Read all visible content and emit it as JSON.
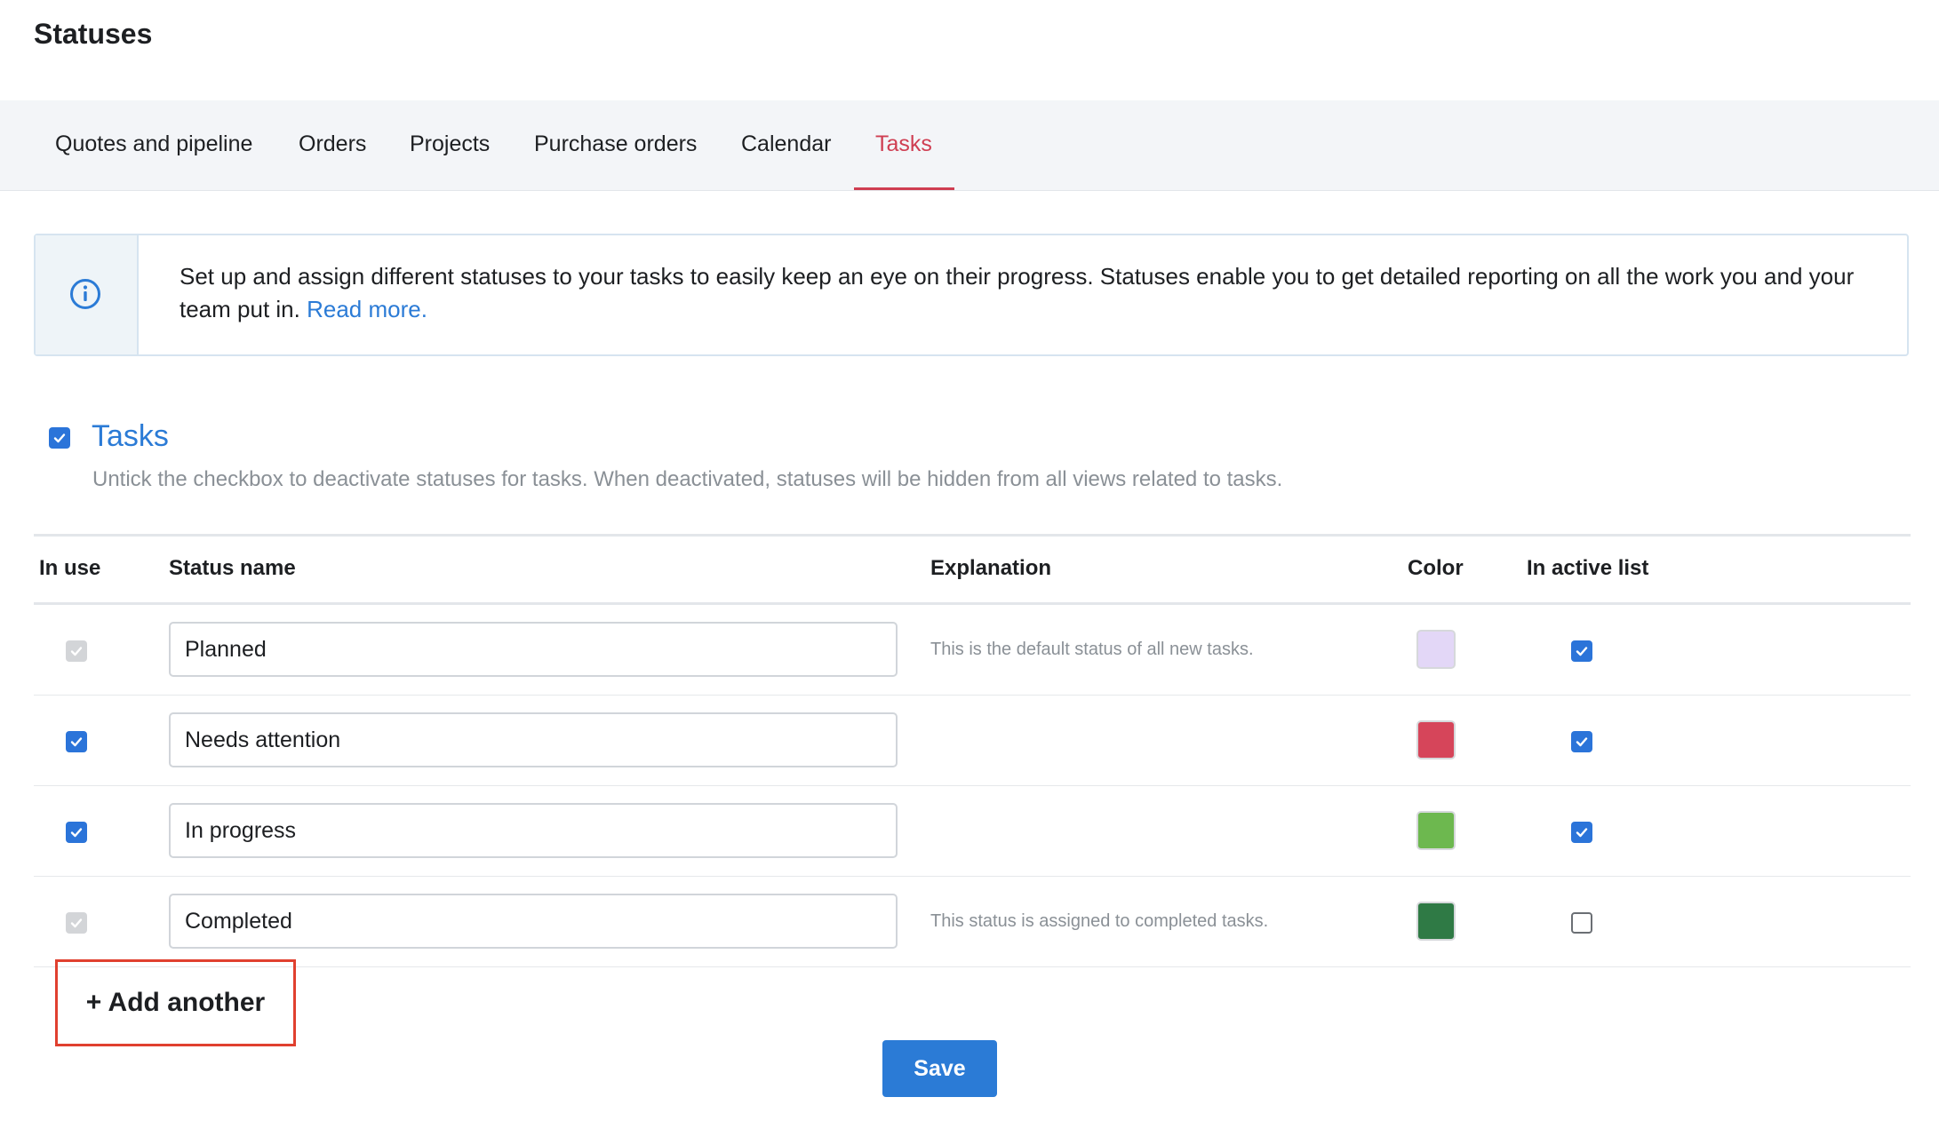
{
  "page": {
    "title": "Statuses"
  },
  "tabs": [
    {
      "label": "Quotes and pipeline",
      "active": false
    },
    {
      "label": "Orders",
      "active": false
    },
    {
      "label": "Projects",
      "active": false
    },
    {
      "label": "Purchase orders",
      "active": false
    },
    {
      "label": "Calendar",
      "active": false
    },
    {
      "label": "Tasks",
      "active": true
    }
  ],
  "info": {
    "text": "Set up and assign different statuses to your tasks to easily keep an eye on their progress. Statuses enable you to get detailed reporting on all the work you and your team put in.",
    "link": "Read more."
  },
  "section": {
    "title": "Tasks",
    "enabled": true,
    "description": "Untick the checkbox to deactivate statuses for tasks. When deactivated, statuses will be hidden from all views related to tasks."
  },
  "table": {
    "headers": {
      "in_use": "In use",
      "status_name": "Status name",
      "explanation": "Explanation",
      "color": "Color",
      "in_active_list": "In active list"
    },
    "rows": [
      {
        "in_use": "disabled",
        "name": "Planned",
        "explanation": "This is the default status of all new tasks.",
        "color": "#e3d7f7",
        "in_active_list": true
      },
      {
        "in_use": "checked",
        "name": "Needs attention",
        "explanation": "",
        "color": "#d6455a",
        "in_active_list": true
      },
      {
        "in_use": "checked",
        "name": "In progress",
        "explanation": "",
        "color": "#6db84f",
        "in_active_list": true
      },
      {
        "in_use": "disabled",
        "name": "Completed",
        "explanation": "This status is assigned to completed tasks.",
        "color": "#2f7a45",
        "in_active_list": false
      }
    ]
  },
  "actions": {
    "add_another": "+ Add another",
    "save": "Save"
  },
  "colors": {
    "accent": "#2b7bd6",
    "active_tab": "#cf3e52",
    "highlight": "#e0402f"
  }
}
